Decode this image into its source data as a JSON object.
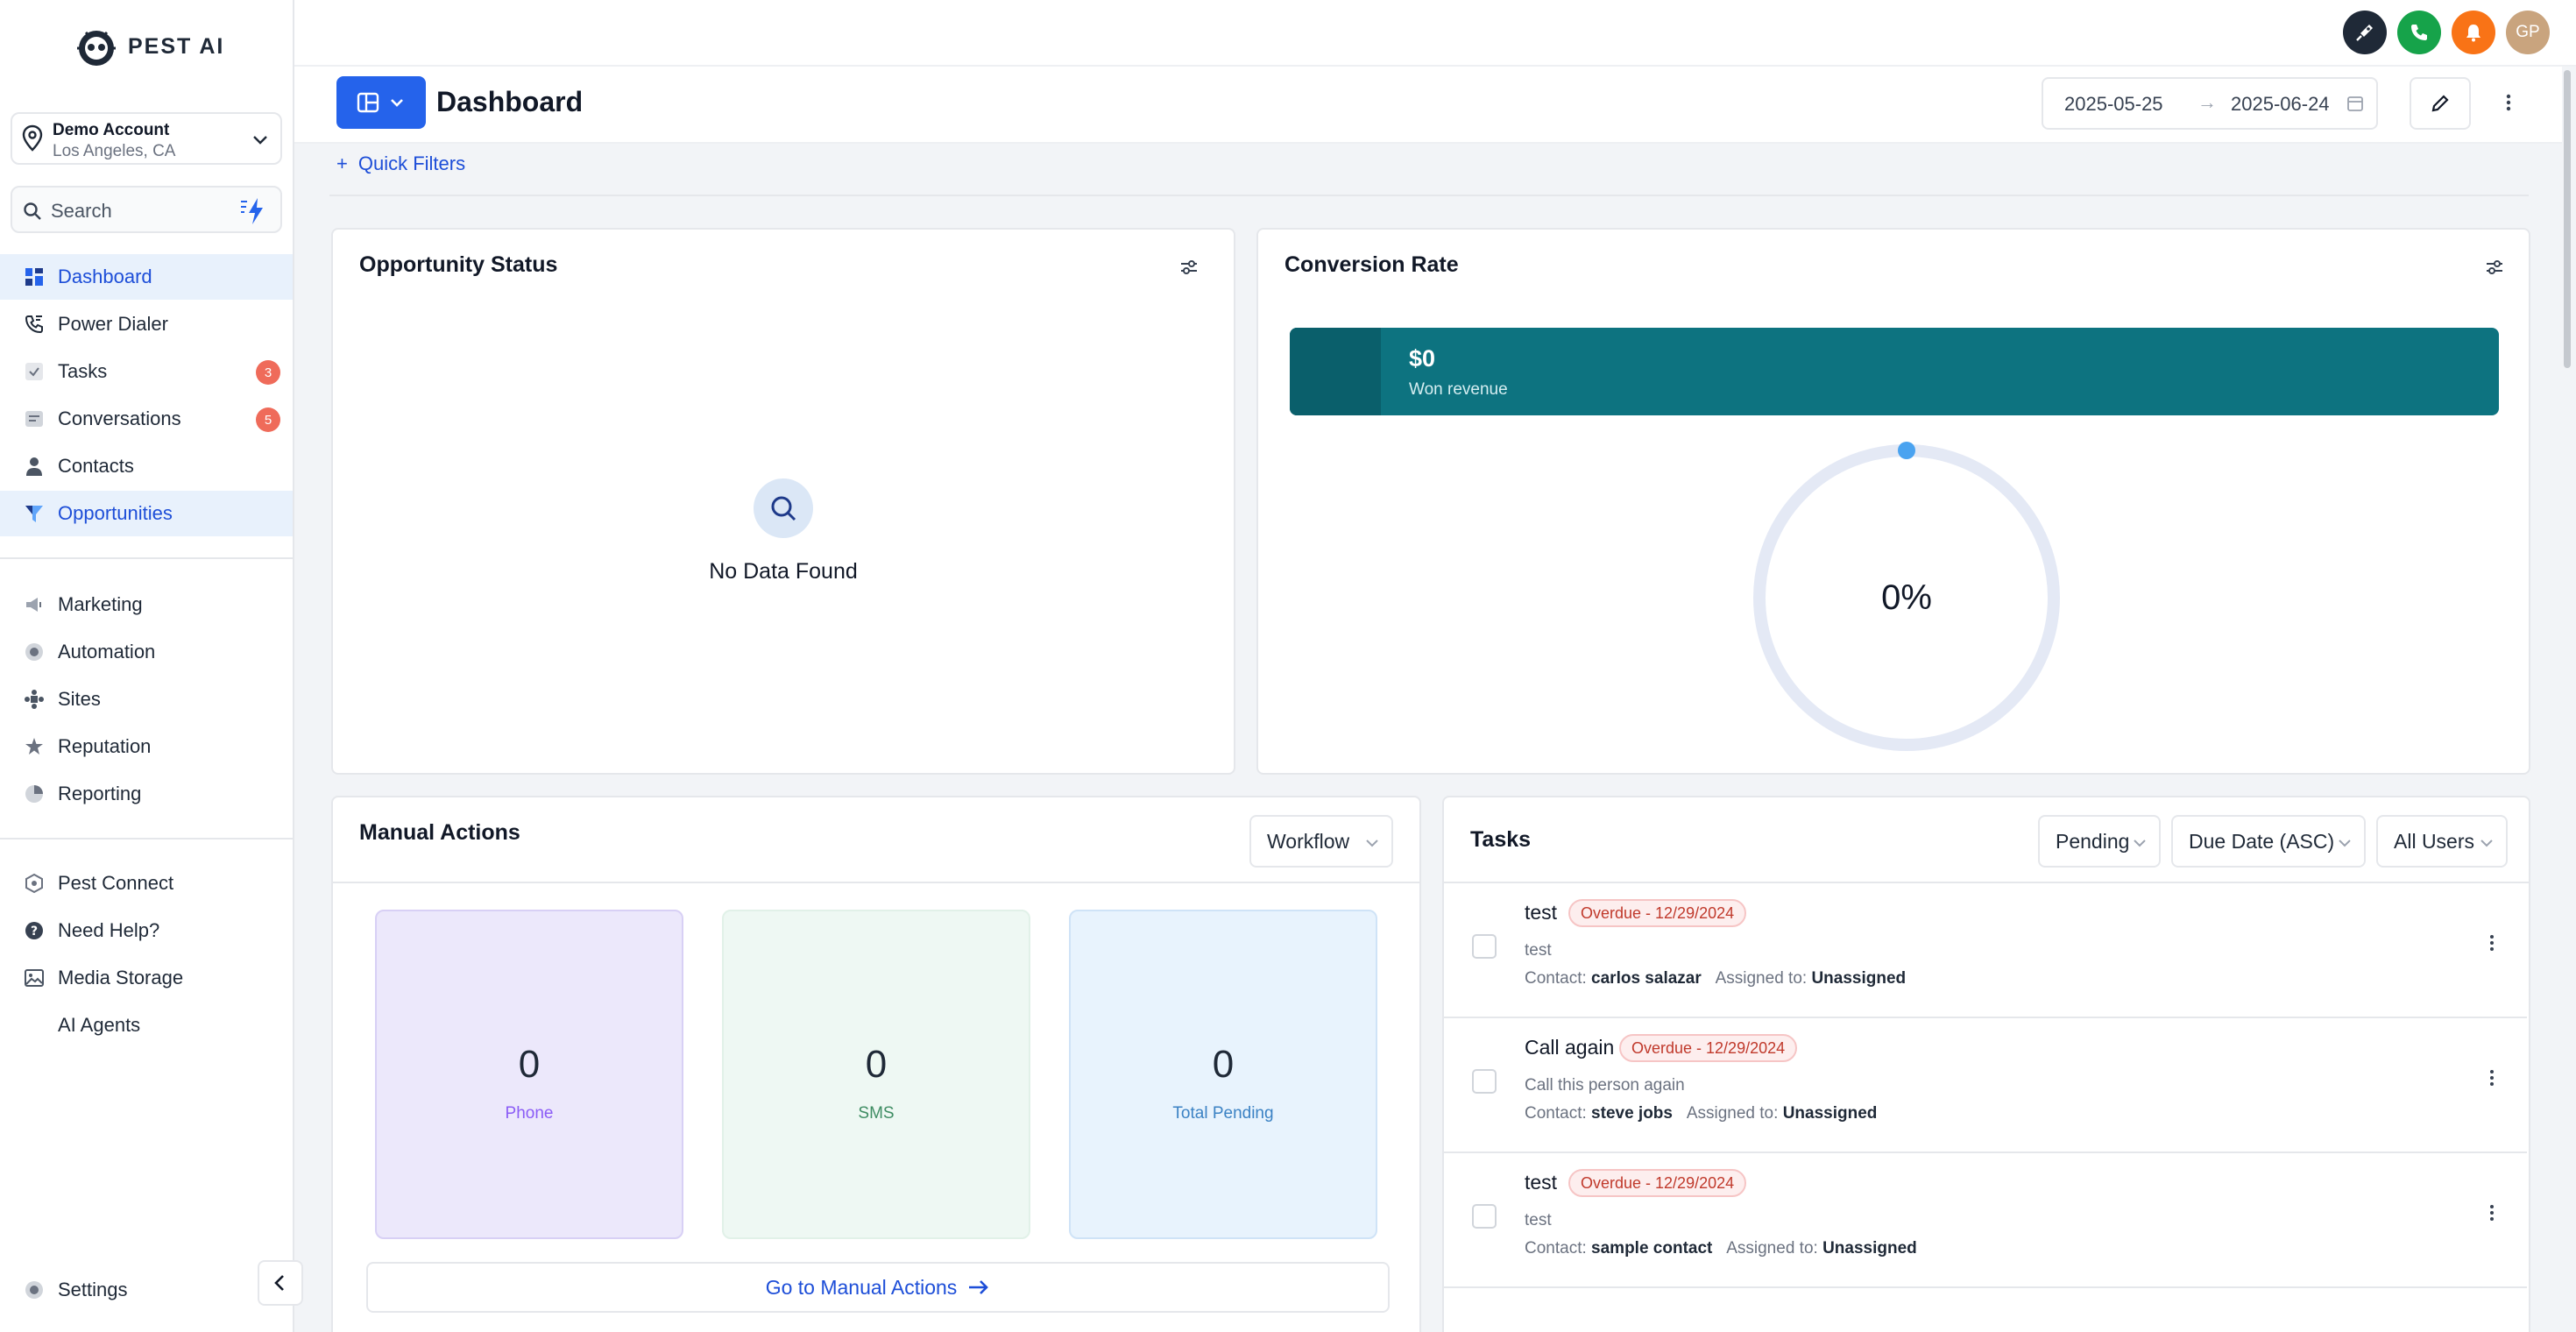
{
  "app": {
    "brand": "PEST AI"
  },
  "account": {
    "name": "Demo Account",
    "location": "Los Angeles, CA"
  },
  "search": {
    "label": "Search"
  },
  "sidebar": {
    "primary": [
      {
        "label": "Dashboard",
        "icon": "dashboard-icon",
        "active": true
      },
      {
        "label": "Power Dialer",
        "icon": "phone-dialer-icon"
      },
      {
        "label": "Tasks",
        "icon": "check-square-icon",
        "badge": "3"
      },
      {
        "label": "Conversations",
        "icon": "chat-icon",
        "badge": "5"
      },
      {
        "label": "Contacts",
        "icon": "person-icon"
      },
      {
        "label": "Opportunities",
        "icon": "funnel-icon",
        "active": true
      }
    ],
    "secondary": [
      {
        "label": "Marketing",
        "icon": "megaphone-icon"
      },
      {
        "label": "Automation",
        "icon": "automation-icon"
      },
      {
        "label": "Sites",
        "icon": "sites-icon"
      },
      {
        "label": "Reputation",
        "icon": "reputation-icon"
      },
      {
        "label": "Reporting",
        "icon": "pie-chart-icon"
      }
    ],
    "tertiary": [
      {
        "label": "Pest Connect",
        "icon": "connect-icon"
      },
      {
        "label": "Need Help?",
        "icon": "help-icon"
      },
      {
        "label": "Media Storage",
        "icon": "image-icon"
      },
      {
        "label": "AI Agents",
        "icon": ""
      }
    ],
    "settings": {
      "label": "Settings",
      "icon": "gear-icon"
    }
  },
  "topbar": {
    "avatar_initials": "GP"
  },
  "header": {
    "title": "Dashboard",
    "date_from": "2025-05-25",
    "date_to": "2025-06-24",
    "quick_filters": "Quick Filters"
  },
  "opportunity_status": {
    "title": "Opportunity Status",
    "empty_text": "No Data Found"
  },
  "conversion_rate": {
    "title": "Conversion Rate",
    "won_amount": "$0",
    "won_label": "Won revenue",
    "rate_text": "0%",
    "rate_value": 0
  },
  "manual_actions": {
    "title": "Manual Actions",
    "filter": "Workflow",
    "stats": [
      {
        "value": "0",
        "label": "Phone"
      },
      {
        "value": "0",
        "label": "SMS"
      },
      {
        "value": "0",
        "label": "Total Pending"
      }
    ],
    "goto_label": "Go to Manual Actions"
  },
  "tasks": {
    "title": "Tasks",
    "filters": [
      "Pending",
      "Due Date (ASC)",
      "All Users"
    ],
    "contact_prefix": "Contact:",
    "assigned_prefix": "Assigned to:",
    "items": [
      {
        "title": "test",
        "badge": "Overdue - 12/29/2024",
        "desc": "test",
        "contact": "carlos salazar",
        "assigned": "Unassigned"
      },
      {
        "title": "Call again",
        "badge": "Overdue - 12/29/2024",
        "desc": "Call this person again",
        "contact": "steve jobs",
        "assigned": "Unassigned"
      },
      {
        "title": "test",
        "badge": "Overdue - 12/29/2024",
        "desc": "test",
        "contact": "sample contact",
        "assigned": "Unassigned"
      }
    ]
  },
  "colors": {
    "accent": "#2563eb",
    "won_bar": "#0d7380",
    "badge_red": "#ef6b5a"
  }
}
